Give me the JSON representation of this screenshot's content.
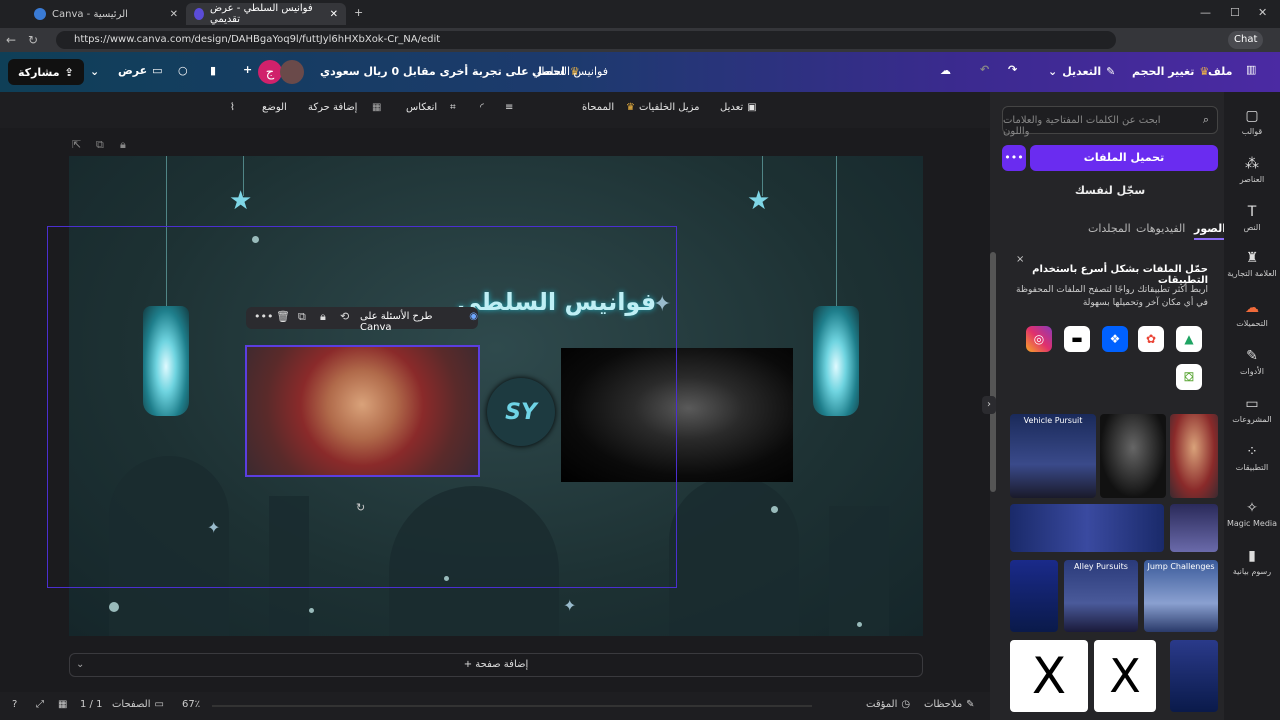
{
  "browser": {
    "tabs": [
      {
        "label": "Canva - الرئيسية"
      },
      {
        "label": "فوانيس السلطي - عرض تقديمي"
      }
    ],
    "url": "https://www.canva.com/design/DAHBgaYoq9l/futtJyl6hHXbXok-Cr_NA/edit",
    "chat_label": "Chat"
  },
  "header": {
    "file": "ملف",
    "resize": "تغيير الحجم",
    "edit_mode": "التعديل",
    "design_title": "فوانيس السلطي",
    "promo": "احصل على تجربة أخرى مقابل 0 ريال سعودي",
    "avatar_letter": "ج",
    "present": "عرض",
    "share": "مشاركة"
  },
  "toolbar": {
    "edit_image": "تعديل",
    "bg_remover": "مزيل الخلفيات",
    "eraser": "الممحاة",
    "flip": "انعكاس",
    "animate": "إضافة حركة",
    "position": "الوضع"
  },
  "canvas": {
    "title_text": "فوانيس السلطي",
    "logo_text": "SY",
    "ask_canva": "طرح الأسئلة على Canva",
    "add_page": "+ إضافة صفحة"
  },
  "sidebar": {
    "search_placeholder": "ابحث عن الكلمات المفتاحية والعلامات واللون",
    "upload": "تحميل الملفات",
    "record": "سجّل لنفسك",
    "tabs": [
      "الصور",
      "الفيديوهات",
      "المجلدات"
    ],
    "promo_title": "حمّل الملفات بشكل أسرع باستخدام التطبيقات",
    "promo_body": "اربط أكثر تطبيقاتك رواجًا لتصفح الملفات المحفوظة في أي مكان آخر وتحميلها بسهولة",
    "thumbs": [
      "Vehicle Pursuit",
      "Alley Pursuits",
      "Jump Challenges"
    ]
  },
  "rail": [
    {
      "label": "قوالب",
      "icon": "template-icon"
    },
    {
      "label": "العناصر",
      "icon": "elements-icon"
    },
    {
      "label": "النص",
      "icon": "text-icon"
    },
    {
      "label": "العلامة التجارية",
      "icon": "brand-icon"
    },
    {
      "label": "التحميلات",
      "icon": "upload-icon"
    },
    {
      "label": "الأدوات",
      "icon": "tools-icon"
    },
    {
      "label": "المشروعات",
      "icon": "folder-icon"
    },
    {
      "label": "التطبيقات",
      "icon": "apps-icon"
    },
    {
      "label": "Magic Media",
      "icon": "magic-icon"
    },
    {
      "label": "رسوم بيانية",
      "icon": "chart-icon"
    }
  ],
  "bottom": {
    "notes": "ملاحظات",
    "timer": "المؤقت",
    "pages": "الصفحات",
    "page_count": "1 / 1",
    "zoom": "67٪"
  }
}
